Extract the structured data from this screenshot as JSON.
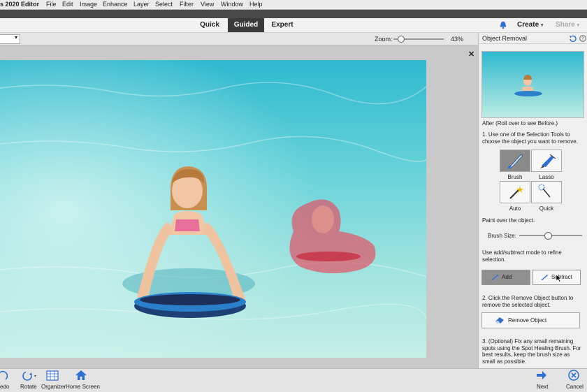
{
  "menubar": {
    "app_title": "s 2020 Editor",
    "items": [
      "File",
      "Edit",
      "Image",
      "Enhance",
      "Layer",
      "Select",
      "Filter",
      "View",
      "Window",
      "Help"
    ]
  },
  "modes": {
    "quick": "Quick",
    "guided": "Guided",
    "expert": "Expert"
  },
  "topright": {
    "create": "Create",
    "share": "Share"
  },
  "options": {
    "zoom_label": "Zoom:",
    "zoom_value": "43%",
    "zoom_level": 0.15
  },
  "panel": {
    "title": "Object Removal",
    "after_text": "After (Roll over to see Before.)",
    "step1": "1. Use one of the Selection Tools to choose the object you want to remove.",
    "tools": {
      "brush": "Brush",
      "lasso": "Lasso",
      "auto": "Auto",
      "quick": "Quick"
    },
    "paint_text": "Paint over the object.",
    "brush_size_label": "Brush Size:",
    "brush_size_level": 0.45,
    "refine_text": "Use add/subtract mode to refine selection.",
    "add_label": "Add",
    "subtract_label": "Subtract",
    "step2": "2. Click the Remove Object button to remove the selected object.",
    "remove_label": "Remove Object",
    "step3": "3. (Optional) Fix any small remaining spots using the Spot Healing Brush. For best results, keep the brush size as small as possible."
  },
  "bottombar": {
    "redo": "edo",
    "rotate": "Rotate",
    "organizer": "Organizer",
    "home": "Home Screen",
    "next": "Next",
    "cancel": "Cancel"
  },
  "colors": {
    "accent_blue": "#2d6fd6",
    "selection_red": "#e8475a",
    "dark_tab": "#3b3b3b"
  }
}
